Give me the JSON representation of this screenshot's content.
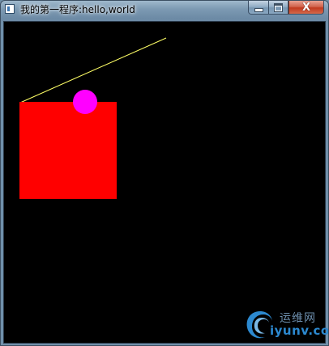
{
  "window": {
    "title": "我的第一程序:hello,world"
  },
  "title_bar": {
    "app_icon": "window-icon",
    "buttons": {
      "minimize_icon": "minimize-icon",
      "maximize_icon": "maximize-icon",
      "close_icon": "close-icon",
      "close_label": "X"
    }
  },
  "scene": {
    "background_color": "#000000",
    "line_color": "#ffff66",
    "square_color": "#ff0000",
    "circle_color": "#ff00ff"
  },
  "watermark": {
    "chinese_text": "运维网",
    "latin_text": "iyunv.com",
    "logo_icon": "swirl-logo-icon"
  }
}
